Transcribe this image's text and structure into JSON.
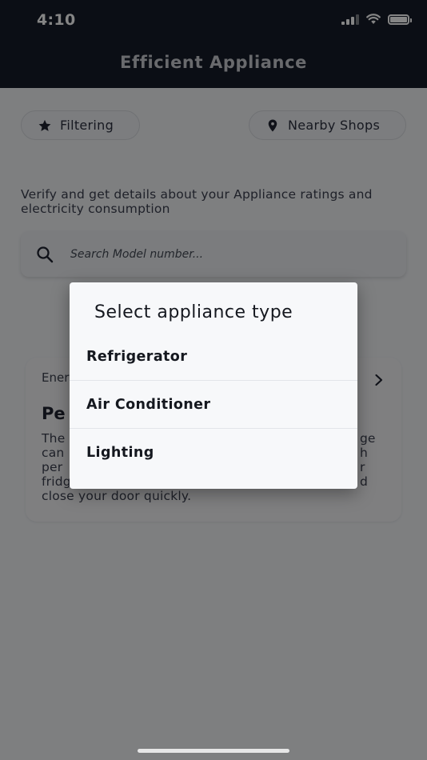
{
  "status_bar": {
    "time": "4:10",
    "icons": [
      "signal-icon",
      "wifi-icon",
      "battery-icon"
    ]
  },
  "app_bar": {
    "title": "Efficient Appliance"
  },
  "chips": {
    "filtering": {
      "label": "Filtering",
      "icon": "star-icon"
    },
    "nearby": {
      "label": "Nearby Shops",
      "icon": "location-pin-icon"
    }
  },
  "description": "Verify and get details about your Appliance ratings and electricity consumption",
  "search": {
    "placeholder": "Search Model number...",
    "icon": "search-icon"
  },
  "tip_card": {
    "category": "Ener",
    "heading": "Pe",
    "body_lines": [
      "The",
      "can",
      "per",
      "fridg",
      "close your door quickly."
    ],
    "body_right_fragments": [
      "ge",
      "h",
      "r",
      "d"
    ]
  },
  "dialog": {
    "title": "Select appliance type",
    "options": [
      {
        "label": "Refrigerator"
      },
      {
        "label": "Air Conditioner"
      },
      {
        "label": "Lighting"
      }
    ]
  },
  "colors": {
    "app_bar": "#161c29",
    "scrim": "rgba(0,0,0,0.48)",
    "dialog": "#f7f8fa"
  }
}
